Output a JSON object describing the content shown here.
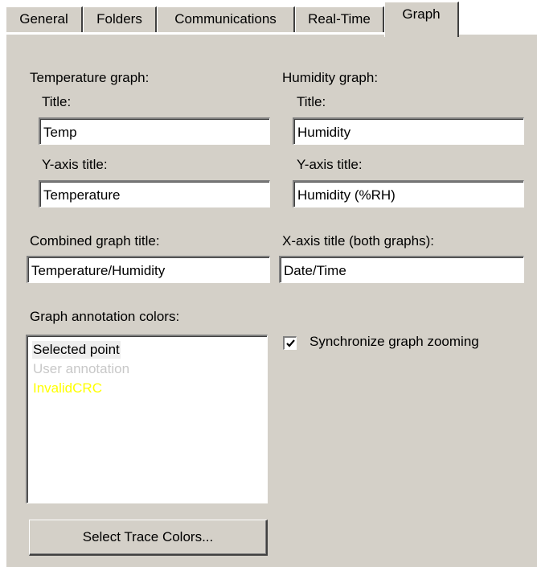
{
  "tabs": {
    "general": "General",
    "folders": "Folders",
    "communications": "Communications",
    "realtime": "Real-Time",
    "graph": "Graph"
  },
  "temperature": {
    "heading": "Temperature graph:",
    "title_label": "Title:",
    "title_value": "Temp",
    "yaxis_label": "Y-axis title:",
    "yaxis_value": "Temperature"
  },
  "humidity": {
    "heading": "Humidity graph:",
    "title_label": "Title:",
    "title_value": "Humidity",
    "yaxis_label": "Y-axis title:",
    "yaxis_value": "Humidity (%RH)"
  },
  "combined": {
    "label": "Combined graph title:",
    "value": "Temperature/Humidity"
  },
  "xaxis": {
    "label": "X-axis title (both graphs):",
    "value": "Date/Time"
  },
  "annotation": {
    "label": "Graph annotation colors:",
    "items": [
      {
        "label": "Selected point",
        "color": "#000000"
      },
      {
        "label": "User annotation",
        "color": "#c8c8c8"
      },
      {
        "label": "InvalidCRC",
        "color": "#ffff00"
      }
    ]
  },
  "sync": {
    "label": "Synchronize graph zooming",
    "checked": true
  },
  "buttons": {
    "select_trace_colors": "Select Trace Colors..."
  }
}
